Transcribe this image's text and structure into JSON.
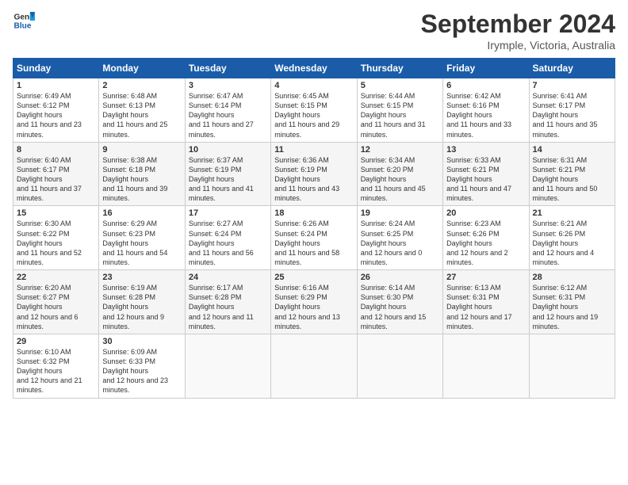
{
  "logo": {
    "line1": "General",
    "line2": "Blue"
  },
  "title": "September 2024",
  "subtitle": "Irymple, Victoria, Australia",
  "headers": [
    "Sunday",
    "Monday",
    "Tuesday",
    "Wednesday",
    "Thursday",
    "Friday",
    "Saturday"
  ],
  "weeks": [
    [
      {
        "day": "1",
        "rise": "6:49 AM",
        "set": "6:12 PM",
        "daylight": "11 hours and 23 minutes."
      },
      {
        "day": "2",
        "rise": "6:48 AM",
        "set": "6:13 PM",
        "daylight": "11 hours and 25 minutes."
      },
      {
        "day": "3",
        "rise": "6:47 AM",
        "set": "6:14 PM",
        "daylight": "11 hours and 27 minutes."
      },
      {
        "day": "4",
        "rise": "6:45 AM",
        "set": "6:15 PM",
        "daylight": "11 hours and 29 minutes."
      },
      {
        "day": "5",
        "rise": "6:44 AM",
        "set": "6:15 PM",
        "daylight": "11 hours and 31 minutes."
      },
      {
        "day": "6",
        "rise": "6:42 AM",
        "set": "6:16 PM",
        "daylight": "11 hours and 33 minutes."
      },
      {
        "day": "7",
        "rise": "6:41 AM",
        "set": "6:17 PM",
        "daylight": "11 hours and 35 minutes."
      }
    ],
    [
      {
        "day": "8",
        "rise": "6:40 AM",
        "set": "6:17 PM",
        "daylight": "11 hours and 37 minutes."
      },
      {
        "day": "9",
        "rise": "6:38 AM",
        "set": "6:18 PM",
        "daylight": "11 hours and 39 minutes."
      },
      {
        "day": "10",
        "rise": "6:37 AM",
        "set": "6:19 PM",
        "daylight": "11 hours and 41 minutes."
      },
      {
        "day": "11",
        "rise": "6:36 AM",
        "set": "6:19 PM",
        "daylight": "11 hours and 43 minutes."
      },
      {
        "day": "12",
        "rise": "6:34 AM",
        "set": "6:20 PM",
        "daylight": "11 hours and 45 minutes."
      },
      {
        "day": "13",
        "rise": "6:33 AM",
        "set": "6:21 PM",
        "daylight": "11 hours and 47 minutes."
      },
      {
        "day": "14",
        "rise": "6:31 AM",
        "set": "6:21 PM",
        "daylight": "11 hours and 50 minutes."
      }
    ],
    [
      {
        "day": "15",
        "rise": "6:30 AM",
        "set": "6:22 PM",
        "daylight": "11 hours and 52 minutes."
      },
      {
        "day": "16",
        "rise": "6:29 AM",
        "set": "6:23 PM",
        "daylight": "11 hours and 54 minutes."
      },
      {
        "day": "17",
        "rise": "6:27 AM",
        "set": "6:24 PM",
        "daylight": "11 hours and 56 minutes."
      },
      {
        "day": "18",
        "rise": "6:26 AM",
        "set": "6:24 PM",
        "daylight": "11 hours and 58 minutes."
      },
      {
        "day": "19",
        "rise": "6:24 AM",
        "set": "6:25 PM",
        "daylight": "12 hours and 0 minutes."
      },
      {
        "day": "20",
        "rise": "6:23 AM",
        "set": "6:26 PM",
        "daylight": "12 hours and 2 minutes."
      },
      {
        "day": "21",
        "rise": "6:21 AM",
        "set": "6:26 PM",
        "daylight": "12 hours and 4 minutes."
      }
    ],
    [
      {
        "day": "22",
        "rise": "6:20 AM",
        "set": "6:27 PM",
        "daylight": "12 hours and 6 minutes."
      },
      {
        "day": "23",
        "rise": "6:19 AM",
        "set": "6:28 PM",
        "daylight": "12 hours and 9 minutes."
      },
      {
        "day": "24",
        "rise": "6:17 AM",
        "set": "6:28 PM",
        "daylight": "12 hours and 11 minutes."
      },
      {
        "day": "25",
        "rise": "6:16 AM",
        "set": "6:29 PM",
        "daylight": "12 hours and 13 minutes."
      },
      {
        "day": "26",
        "rise": "6:14 AM",
        "set": "6:30 PM",
        "daylight": "12 hours and 15 minutes."
      },
      {
        "day": "27",
        "rise": "6:13 AM",
        "set": "6:31 PM",
        "daylight": "12 hours and 17 minutes."
      },
      {
        "day": "28",
        "rise": "6:12 AM",
        "set": "6:31 PM",
        "daylight": "12 hours and 19 minutes."
      }
    ],
    [
      {
        "day": "29",
        "rise": "6:10 AM",
        "set": "6:32 PM",
        "daylight": "12 hours and 21 minutes."
      },
      {
        "day": "30",
        "rise": "6:09 AM",
        "set": "6:33 PM",
        "daylight": "12 hours and 23 minutes."
      },
      null,
      null,
      null,
      null,
      null
    ]
  ]
}
